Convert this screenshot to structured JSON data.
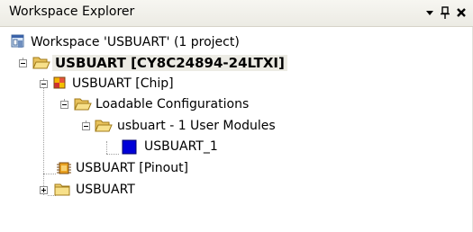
{
  "panel": {
    "title": "Workspace Explorer",
    "buttons": {
      "dropdown": "▼",
      "pin": "⊥",
      "close": "✕"
    }
  },
  "tree": {
    "workspace": "Workspace 'USBUART' (1 project)",
    "project": "USBUART [CY8C24894-24LTXI]",
    "chip": "USBUART [Chip]",
    "loadable": "Loadable Configurations",
    "config": "usbuart - 1 User Modules",
    "module": "USBUART_1",
    "pinout": "USBUART [Pinout]",
    "folder": "USBUART"
  },
  "colors": {
    "title_bar": "#ecebe4",
    "selected_bg": "#ecebe4",
    "module_icon": "#0000d8"
  }
}
